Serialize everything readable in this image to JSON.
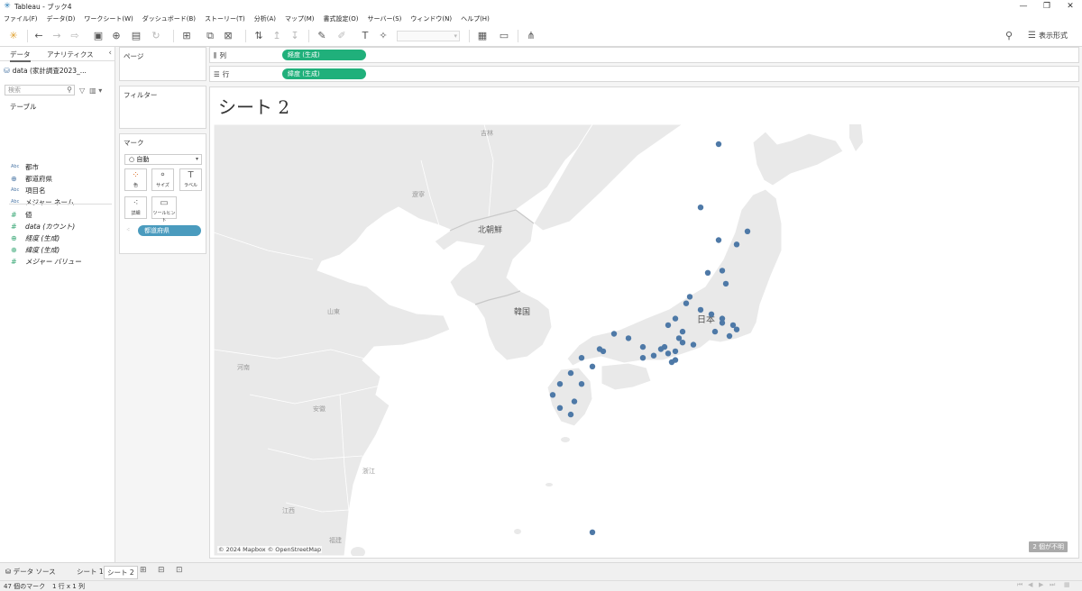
{
  "window": {
    "title": "Tableau - ブック4",
    "minimize": "—",
    "restore": "❐",
    "close": "✕"
  },
  "menu": [
    "ファイル(F)",
    "データ(D)",
    "ワークシート(W)",
    "ダッシュボード(B)",
    "ストーリー(T)",
    "分析(A)",
    "マップ(M)",
    "書式設定(O)",
    "サーバー(S)",
    "ウィンドウ(N)",
    "ヘルプ(H)"
  ],
  "toolbar": {
    "show_me_label": "表示形式"
  },
  "data_pane": {
    "tab_data": "データ",
    "tab_analytics": "アナリティクス",
    "datasource": "data (家計調査2023_...",
    "search_placeholder": "検索",
    "tables_header": "テーブル",
    "dimensions": [
      {
        "type": "Abc",
        "name": "都市"
      },
      {
        "type": "geo",
        "name": "都道府県"
      },
      {
        "type": "Abc",
        "name": "項目名"
      },
      {
        "type": "Abc",
        "name": "メジャー ネーム"
      }
    ],
    "measures": [
      {
        "type": "#",
        "name": "値"
      },
      {
        "type": "=#",
        "name": "data (カウント)"
      },
      {
        "type": "geo",
        "name": "経度 (生成)"
      },
      {
        "type": "geo",
        "name": "緯度 (生成)"
      },
      {
        "type": "#",
        "name": "メジャー バリュー"
      }
    ]
  },
  "cards": {
    "pages": "ページ",
    "filters": "フィルター",
    "marks": "マーク",
    "mark_type": "自動",
    "mark_buttons": [
      "色",
      "サイズ",
      "ラベル",
      "詳細",
      "ツールヒント"
    ],
    "detail_pill": "都道府県"
  },
  "shelves": {
    "columns_label": "列",
    "columns_pill": "経度 (生成)",
    "rows_label": "行",
    "rows_pill": "緯度 (生成)"
  },
  "sheet": {
    "title": "シート 2",
    "attribution": "© 2024 Mapbox © OpenStreetMap",
    "unknown_badge": "2 個が不明",
    "map_labels": {
      "jilin": "吉林",
      "liaoning": "遼寧",
      "north_korea": "北朝鮮",
      "south_korea": "韓国",
      "japan": "日本",
      "shandong": "山東",
      "henan": "河南",
      "anhui": "安徽",
      "zhejiang": "浙江",
      "jiangxi": "江西",
      "fujian": "福建"
    }
  },
  "bottom_tabs": {
    "datasource": "データ ソース",
    "sheet1": "シート 1",
    "sheet2": "シート 2"
  },
  "status": {
    "marks": "47 個のマーク",
    "dims": "1 行 x 1 列"
  },
  "colors": {
    "mark": "#4e79a7",
    "geo_pill": "#20b07b",
    "detail_pill": "#4a9bbe",
    "land": "#e9e9e9",
    "sea": "#ffffff"
  },
  "prefecture_points": [
    [
      1.5,
      44.0
    ],
    [
      1.0,
      41.1
    ],
    [
      1.5,
      39.6
    ],
    [
      2.0,
      39.4
    ],
    [
      2.3,
      40.0
    ],
    [
      1.2,
      38.1
    ],
    [
      1.6,
      38.2
    ],
    [
      1.7,
      37.6
    ],
    [
      1.0,
      36.4
    ],
    [
      1.3,
      36.2
    ],
    [
      1.6,
      36.0
    ],
    [
      1.6,
      35.8
    ],
    [
      1.9,
      35.7
    ],
    [
      1.4,
      35.4
    ],
    [
      1.8,
      35.2
    ],
    [
      2.0,
      35.5
    ],
    [
      0.7,
      37.0
    ],
    [
      0.6,
      36.7
    ],
    [
      0.3,
      36.0
    ],
    [
      0.5,
      35.4
    ],
    [
      0.1,
      35.7
    ],
    [
      0.4,
      35.1
    ],
    [
      0.8,
      34.8
    ],
    [
      0.3,
      34.5
    ],
    [
      0.5,
      34.9
    ],
    [
      0.3,
      34.1
    ],
    [
      0.1,
      34.4
    ],
    [
      0.2,
      34.0
    ],
    [
      0.0,
      34.7
    ],
    [
      -0.1,
      34.6
    ],
    [
      -0.6,
      34.2
    ],
    [
      -0.3,
      34.3
    ],
    [
      -1.0,
      35.1
    ],
    [
      -0.6,
      34.7
    ],
    [
      -1.4,
      35.3
    ],
    [
      -1.7,
      34.5
    ],
    [
      -2.0,
      33.8
    ],
    [
      -1.8,
      34.6
    ],
    [
      -2.3,
      34.2
    ],
    [
      -2.6,
      33.5
    ],
    [
      -2.9,
      33.0
    ],
    [
      -3.1,
      32.5
    ],
    [
      -2.3,
      33.0
    ],
    [
      -2.5,
      32.2
    ],
    [
      -2.9,
      31.9
    ],
    [
      -2.6,
      31.6
    ],
    [
      -2.0,
      26.2
    ]
  ]
}
